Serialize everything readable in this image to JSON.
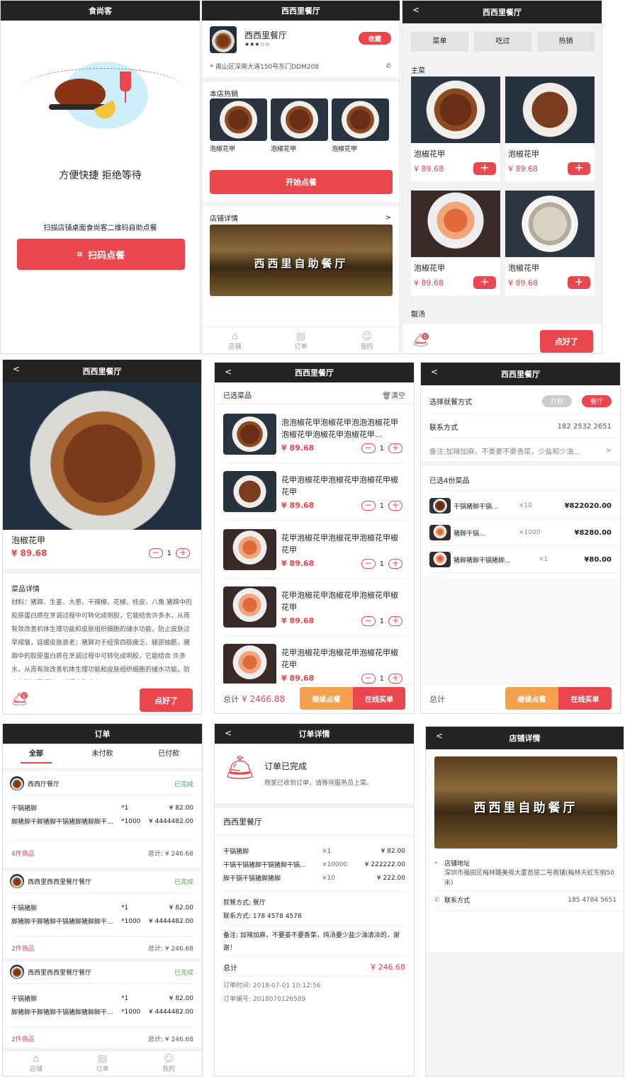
{
  "s1": {
    "title": "食尚客",
    "headline": "方便快捷 拒绝等待",
    "desc": "扫描店铺桌面食尚客二维码自助点餐",
    "scan_btn": "扫码点餐"
  },
  "s2": {
    "title": "西西里餐厅",
    "name": "西西里餐厅",
    "stars": "★★★☆☆",
    "fav": "收藏",
    "address": "南山区深南大道150号东门DDM208",
    "hot_title": "本店热销",
    "hot": [
      "泡椒花甲",
      "泡椒花甲",
      "泡椒花甲"
    ],
    "start_btn": "开始点餐",
    "shop_title": "店铺详情",
    "shop_arrow": ">",
    "banner": "西西里自助餐厅",
    "tabs": [
      "店铺",
      "订单",
      "我的"
    ]
  },
  "s3": {
    "title": "西西里餐厅",
    "back": "<",
    "cats": [
      "菜单",
      "吃过",
      "热销"
    ],
    "sec1": "主菜",
    "sec2": "靓汤",
    "items": [
      {
        "name": "泡椒花甲",
        "price": "¥ 89.68"
      },
      {
        "name": "泡椒花甲",
        "price": "¥ 89.68"
      },
      {
        "name": "泡椒花甲",
        "price": "¥ 89.68"
      },
      {
        "name": "泡椒花甲",
        "price": "¥ 89.68"
      }
    ],
    "badge": "0",
    "done_btn": "点好了"
  },
  "s4": {
    "title": "西西里餐厅",
    "back": "<",
    "name": "泡椒花甲",
    "price": "¥ 89.68",
    "qty": "1",
    "detail_title": "菜品详情",
    "detail": "材料：猪蹄、生姜、大葱、干辣椒、花椒、桂皮、八角 猪蹄中的胶原蛋白质在烹调过程中可转化成明胶，它能结合许多水，从而有效改善机体生理功能和皮肤组织细胞的储水功能，防止皮肤过早褶皱，延缓皮肤衰老；猪蹄对于经常四肢疲乏、腿部抽筋，猪蹄中的胶原蛋白质在烹调过程中可转化成明胶，它能结合 许多水，从而有效改善机体生理功能和皮肤组织细胞的储水功能，防止皮肤过早褶皱，延缓皮肤衰老；",
    "badge": "0",
    "done_btn": "点好了"
  },
  "s5": {
    "title": "西西里餐厅",
    "back": "<",
    "header": "已选菜品",
    "clear": "清空",
    "items": [
      {
        "name": "泡泡椒花甲泡椒花甲泡泡泡椒花甲泡椒花甲泡椒花甲泡椒花甲...",
        "price": "¥ 89.68",
        "qty": "1"
      },
      {
        "name": "花甲泡椒花甲泡椒花甲泡椒花甲椒花甲",
        "price": "¥ 89.68",
        "qty": "1"
      },
      {
        "name": "花甲泡椒花甲泡椒花甲泡椒花甲椒花甲",
        "price": "¥ 89.68",
        "qty": "1"
      },
      {
        "name": "花甲泡椒花甲泡椒花甲泡椒花甲椒花甲",
        "price": "¥ 89.68",
        "qty": "1"
      },
      {
        "name": "花甲泡椒花甲泡椒花甲泡椒花甲椒花甲",
        "price": "¥ 89.68",
        "qty": "1"
      }
    ],
    "total_label": "总计",
    "total": "¥ 2466.88",
    "cont_btn": "继续点餐",
    "buy_btn": "在线买单"
  },
  "s6": {
    "title": "西西里餐厅",
    "back": "<",
    "mode_label": "选择就餐方式",
    "mode_a": "打包",
    "mode_b": "餐厅",
    "phone_label": "联系方式",
    "phone": "182 2532 2651",
    "note": "备注:加辣加麻，不要姜不要香菜，少盐和少油...",
    "note_arrow": ">",
    "sel_title": "已选4份菜品",
    "items": [
      {
        "name": "干锅猪脚干锅...",
        "qty": "×10",
        "price": "¥822020.00"
      },
      {
        "name": "猪脚干锅...",
        "qty": "×1000",
        "price": "¥8280.00"
      },
      {
        "name": "猪脚猪脚干锅猪脚...",
        "qty": "×1",
        "price": "¥80.00"
      }
    ],
    "total_label": "总计",
    "cont_btn": "继续点餐",
    "buy_btn": "在线买单"
  },
  "s7": {
    "title": "订单",
    "tabs": [
      "全部",
      "未付款",
      "已付款"
    ],
    "orders": [
      {
        "shop": "西西厅餐厅",
        "status": "已完成",
        "l1": "干锅猪脚",
        "q1": "*1",
        "p1": "¥ 82.00",
        "l2": "脚猪脚干脚猪脚干锅猪脚猪脚脚干...",
        "q2": "*1000",
        "p2": "¥ 4444482.00",
        "count": "4件商品",
        "total": "总计: ¥ 246.68"
      },
      {
        "shop": "西西里西西里餐厅餐厅",
        "status": "已完成",
        "l1": "干锅猪脚",
        "q1": "*1",
        "p1": "¥ 82.00",
        "l2": "脚猪脚干脚猪脚干锅猪脚猪脚脚干...",
        "q2": "*1000",
        "p2": "¥ 4444482.00",
        "count": "2件商品",
        "total": "总计: ¥ 246.68"
      },
      {
        "shop": "西西里西西里餐厅餐厅",
        "status": "已完成",
        "l1": "干锅猪脚",
        "q1": "*1",
        "p1": "¥ 82.00",
        "l2": "脚猪脚干脚猪脚干锅猪脚猪脚脚干...",
        "q2": "*1000",
        "p2": "¥ 4444482.00",
        "count": "2件商品",
        "total": "总计: ¥ 246.68"
      }
    ],
    "navtabs": [
      "店铺",
      "订单",
      "我的"
    ]
  },
  "s8": {
    "title": "订单详情",
    "back": "<",
    "status": "订单已完成",
    "status_desc": "商家已收到订单，请等待服务员上菜。",
    "shop": "西西里餐厅",
    "items": [
      {
        "name": "干锅猪脚",
        "qty": "×1",
        "price": "¥ 82.00"
      },
      {
        "name": "干锅干锅猪脚干锅猪脚干锅...",
        "qty": "×10000",
        "price": "¥ 222222.00"
      },
      {
        "name": "脚干锅干锅猪脚猪脚",
        "qty": "×10",
        "price": "¥ 222.00"
      }
    ],
    "mode": "就餐方式: 餐厅",
    "phone": "联系方式: 178 4578 4578",
    "note": "备注: 加辣加麻，不要姜不要香菜，炖汤要少盐少油清淡的，谢谢！",
    "total_label": "总计",
    "total": "¥ 246.68",
    "time": "订单时间: 2018-07-01 10:12:56",
    "no": "订单编号: 2018070126589"
  },
  "s9": {
    "title": "店铺详情",
    "back": "<",
    "banner": "西西里自助餐厅",
    "addr_label": "店铺地址",
    "addr": "深圳市福田区梅林路美视大厦首层二号商铺(梅林天虹东侧50米)",
    "phone_label": "联系方式",
    "phone": "185 4784 5651"
  }
}
